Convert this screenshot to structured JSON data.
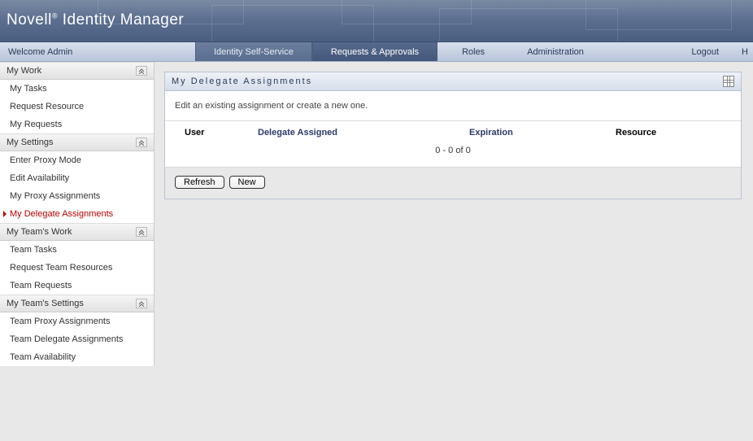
{
  "brand": {
    "name": "Novell",
    "reg": "®",
    "product": "Identity Manager"
  },
  "welcome": "Welcome Admin",
  "nav": {
    "self_service": "Identity Self-Service",
    "requests": "Requests & Approvals",
    "roles": "Roles",
    "admin": "Administration",
    "logout": "Logout",
    "help": "H"
  },
  "sidebar": {
    "sections": [
      {
        "title": "My Work",
        "items": [
          "My Tasks",
          "Request Resource",
          "My Requests"
        ]
      },
      {
        "title": "My Settings",
        "items": [
          "Enter Proxy Mode",
          "Edit Availability",
          "My Proxy Assignments",
          "My Delegate Assignments"
        ]
      },
      {
        "title": "My Team's Work",
        "items": [
          "Team Tasks",
          "Request Team Resources",
          "Team Requests"
        ]
      },
      {
        "title": "My Team's Settings",
        "items": [
          "Team Proxy Assignments",
          "Team Delegate Assignments",
          "Team Availability"
        ]
      }
    ],
    "active": "My Delegate Assignments"
  },
  "panel": {
    "title": "My Delegate Assignments",
    "subtext": "Edit an existing assignment or create a new one.",
    "columns": {
      "user": "User",
      "delegate": "Delegate Assigned",
      "expiration": "Expiration",
      "resource": "Resource"
    },
    "empty": "0 - 0 of 0",
    "buttons": {
      "refresh": "Refresh",
      "new": "New"
    }
  }
}
